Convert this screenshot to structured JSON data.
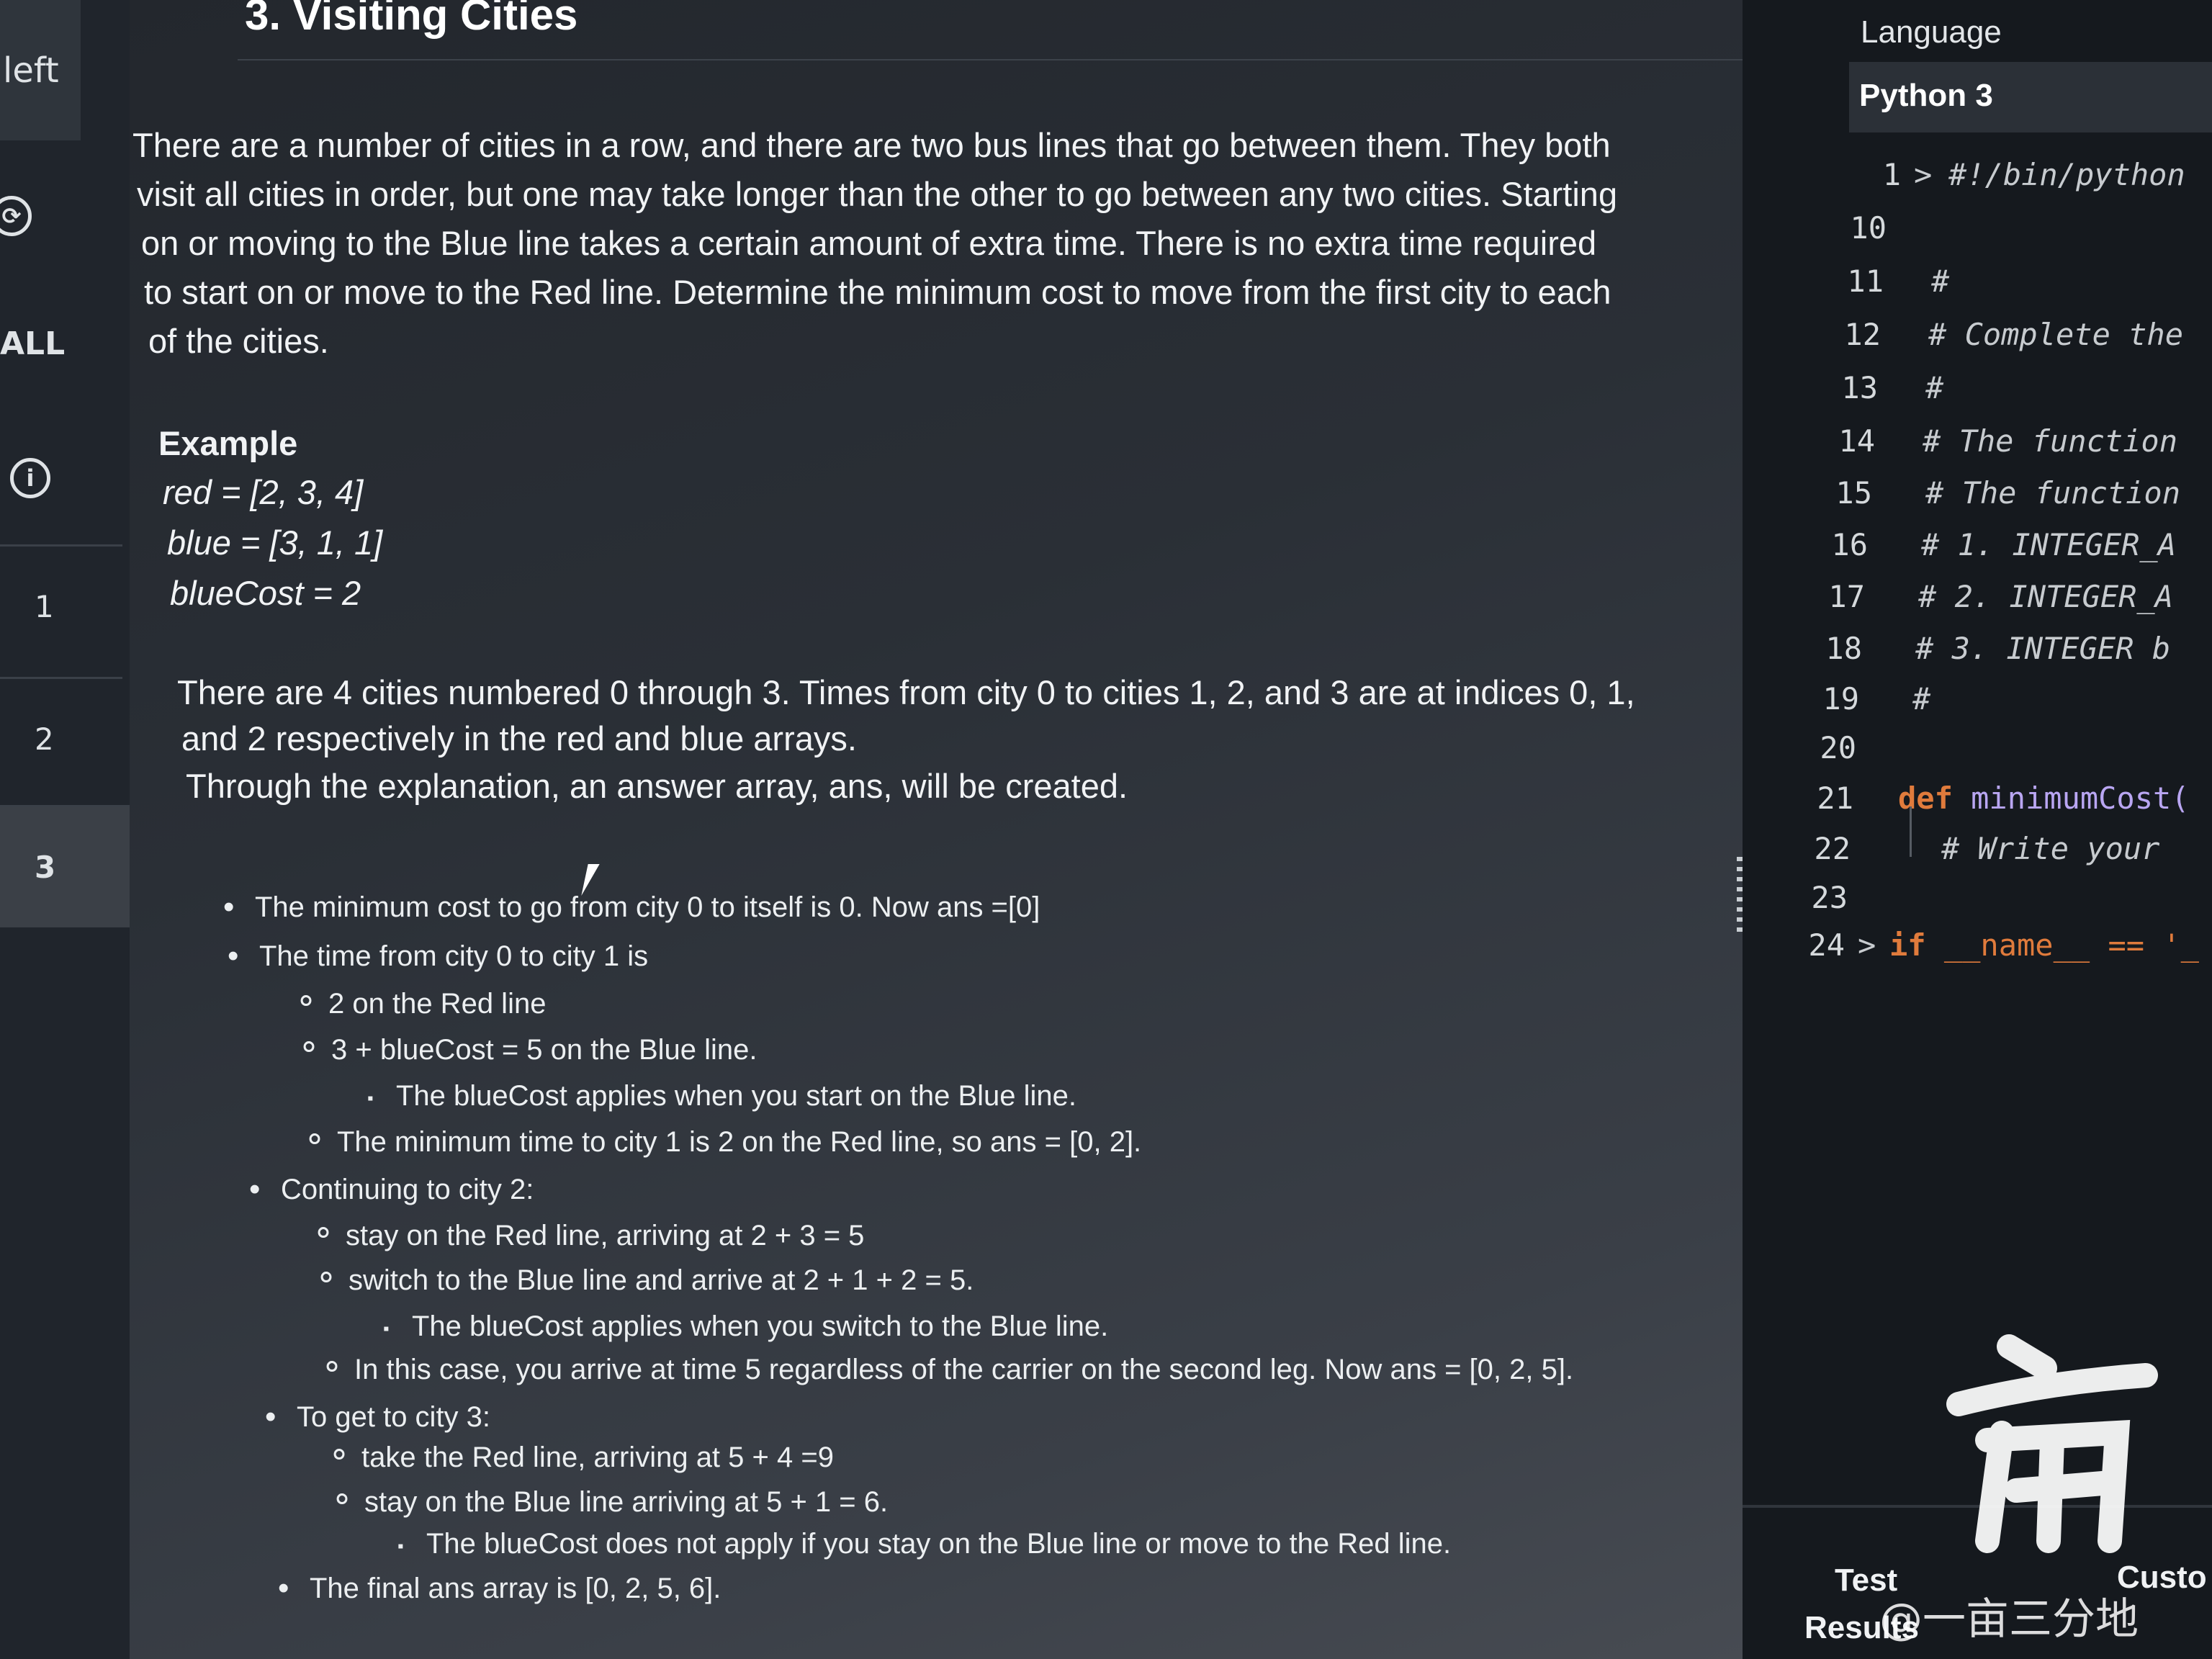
{
  "sidebar": {
    "top_label": "left",
    "refresh_icon": "refresh-icon",
    "all_label": "ALL",
    "info_icon": "info-icon",
    "questions": [
      "1",
      "2",
      "3"
    ],
    "active_question": "3"
  },
  "problem": {
    "title": "3. Visiting Cities",
    "intro": [
      "There are a number of cities in a row, and there are two bus lines that go between them. They both",
      "visit all cities in order, but one may take longer than the other to go between any two cities. Starting",
      "on or moving to the Blue line takes a certain amount of extra time. There is no extra time required",
      "to start on or move to the Red line. Determine the minimum cost to move from the first city to each",
      "of the cities."
    ],
    "example_heading": "Example",
    "example_lines": [
      "red = [2, 3, 4]",
      "blue = [3, 1, 1]",
      "blueCost = 2"
    ],
    "explanation": [
      "There are 4 cities numbered 0 through 3. Times from city 0 to cities 1, 2, and 3 are at indices 0, 1,",
      "and 2 respectively in the red and blue arrays.",
      "Through the explanation, an answer array, ans, will be created."
    ],
    "bullets": [
      {
        "level": 1,
        "text": "The minimum cost to go from city 0 to itself is 0. Now ans =[0]"
      },
      {
        "level": 1,
        "text": "The time from city 0 to city 1 is"
      },
      {
        "level": 2,
        "text": "2 on the Red line"
      },
      {
        "level": 2,
        "text": "3 + blueCost = 5 on the Blue line."
      },
      {
        "level": 3,
        "text": "The blueCost applies when you start on the Blue line."
      },
      {
        "level": 2,
        "text": "The minimum time to city 1 is 2 on the Red line, so ans = [0, 2]."
      },
      {
        "level": 1,
        "text": "Continuing to city 2:"
      },
      {
        "level": 2,
        "text": "stay on the Red line, arriving at 2 + 3 = 5"
      },
      {
        "level": 2,
        "text": "switch to the Blue line and arrive at 2 + 1 + 2 = 5."
      },
      {
        "level": 3,
        "text": "The blueCost applies when you switch to the Blue line."
      },
      {
        "level": 2,
        "text": "In this case, you arrive at time 5 regardless of the carrier on the second leg. Now ans = [0, 2, 5]."
      },
      {
        "level": 1,
        "text": "To get to city 3:"
      },
      {
        "level": 2,
        "text": "take the Red line, arriving at 5 + 4 =9"
      },
      {
        "level": 2,
        "text": "stay on the Blue line arriving at 5 + 1 = 6."
      },
      {
        "level": 3,
        "text": "The blueCost does not apply if you stay on the Blue line or move to the Red line."
      },
      {
        "level": 1,
        "text": "The final ans array is [0, 2, 5, 6]."
      }
    ]
  },
  "editor": {
    "language_label": "Language",
    "language_value": "Python 3",
    "lines": [
      {
        "num": "1",
        "fold": true,
        "text": "#!/bin/python"
      },
      {
        "num": "10",
        "fold": false,
        "text": ""
      },
      {
        "num": "11",
        "fold": false,
        "text": "#"
      },
      {
        "num": "12",
        "fold": false,
        "text": "# Complete the"
      },
      {
        "num": "13",
        "fold": false,
        "text": "#"
      },
      {
        "num": "14",
        "fold": false,
        "text": "# The function"
      },
      {
        "num": "15",
        "fold": false,
        "text": "# The function"
      },
      {
        "num": "16",
        "fold": false,
        "text": "#  1. INTEGER_A"
      },
      {
        "num": "17",
        "fold": false,
        "text": "#  2. INTEGER_A"
      },
      {
        "num": "18",
        "fold": false,
        "text": "#  3. INTEGER b"
      },
      {
        "num": "19",
        "fold": false,
        "text": "#"
      },
      {
        "num": "20",
        "fold": false,
        "text": ""
      },
      {
        "num": "21",
        "fold": false,
        "text": "def minimumCost("
      },
      {
        "num": "22",
        "fold": false,
        "text": "# Write your"
      },
      {
        "num": "23",
        "fold": false,
        "text": ""
      },
      {
        "num": "24",
        "fold": true,
        "text": "if __name__ == '_"
      }
    ],
    "bottom_left": [
      "Test",
      "Results"
    ],
    "bottom_right": "Custo",
    "watermark": "@一亩三分地"
  }
}
